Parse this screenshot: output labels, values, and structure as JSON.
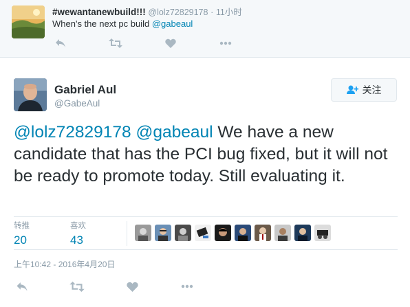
{
  "parent_tweet": {
    "name": "#wewantanewbuild!!!",
    "handle": "@lolz72829178",
    "separator": "·",
    "time": "11小时",
    "text_prefix": "When's the next pc build ",
    "text_mention": "@gabeaul",
    "actions": [
      "reply-icon",
      "retweet-icon",
      "like-icon",
      "more-icon"
    ]
  },
  "main_tweet": {
    "name": "Gabriel Aul",
    "handle": "@GabeAul",
    "follow_label": "关注",
    "text_mention_1": "@lolz72829178",
    "text_mention_2": "@gabeaul",
    "text_body": " We have a new candidate that has the PCI bug fixed, but it will not be ready to promote today. Still evaluating it.",
    "stats": {
      "retweets_label": "转推",
      "retweets_value": "20",
      "likes_label": "喜欢",
      "likes_value": "43"
    },
    "liker_avatar_count": 10,
    "timestamp": "上午10:42 - 2016年4月20日",
    "actions": [
      "reply-icon",
      "retweet-icon",
      "like-icon",
      "more-icon"
    ]
  },
  "colors": {
    "link": "#0084b4",
    "muted": "#8899a6",
    "icon": "#aab8c2",
    "text": "#292f33",
    "context_bg": "#f5f8fa"
  }
}
